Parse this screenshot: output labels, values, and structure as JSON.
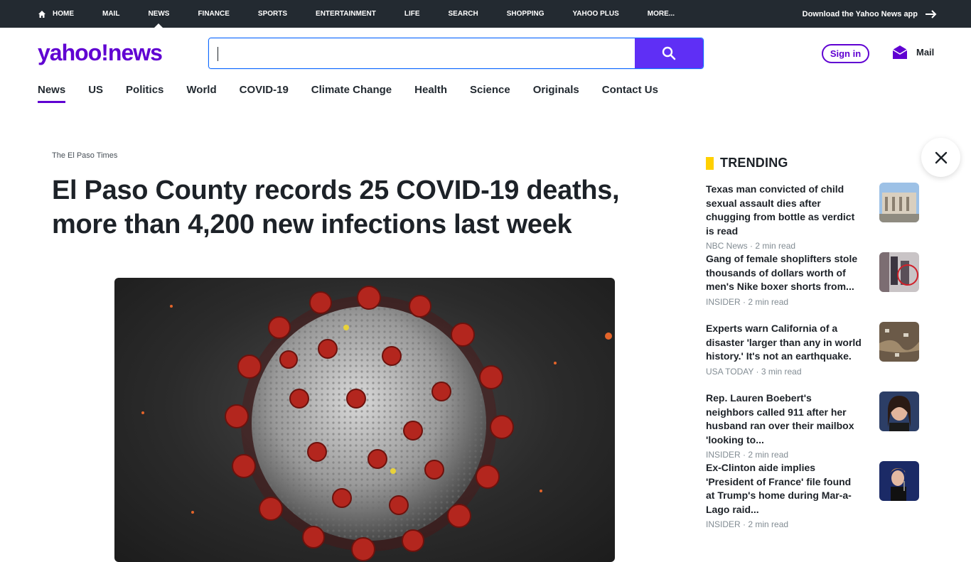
{
  "topnav": {
    "items": [
      "HOME",
      "MAIL",
      "NEWS",
      "FINANCE",
      "SPORTS",
      "ENTERTAINMENT",
      "LIFE",
      "SEARCH",
      "SHOPPING",
      "YAHOO PLUS",
      "MORE..."
    ],
    "download": "Download the Yahoo News app"
  },
  "header": {
    "logo_yahoo": "yahoo!",
    "logo_news": "news",
    "search_placeholder": "",
    "signin": "Sign in",
    "mail": "Mail"
  },
  "subnav": [
    "News",
    "US",
    "Politics",
    "World",
    "COVID-19",
    "Climate Change",
    "Health",
    "Science",
    "Originals",
    "Contact Us"
  ],
  "article": {
    "source": "The El Paso Times",
    "headline": "El Paso County records 25 COVID-19 deaths, more than 4,200 new infections last week"
  },
  "trending": {
    "heading": "TRENDING",
    "items": [
      {
        "title": "Texas man convicted of child sexual assault dies after chugging from bottle as verdict is read",
        "source": "NBC News",
        "read": "2 min read"
      },
      {
        "title": "Gang of female shoplifters stole thousands of dollars worth of men's Nike boxer shorts from...",
        "source": "INSIDER",
        "read": "2 min read"
      },
      {
        "title": "Experts warn California of a disaster 'larger than any in world history.' It's not an earthquake.",
        "source": "USA TODAY",
        "read": "3 min read"
      },
      {
        "title": "Rep. Lauren Boebert's neighbors called 911 after her husband ran over their mailbox 'looking to...",
        "source": "INSIDER",
        "read": "2 min read"
      },
      {
        "title": "Ex-Clinton aide implies 'President of France' file found at Trump's home during Mar-a-Lago raid...",
        "source": "INSIDER",
        "read": "2 min read"
      }
    ]
  },
  "colors": {
    "brand": "#6001d2",
    "search_button": "#5f2ff5",
    "topbar": "#232a31",
    "trending_accent": "#ffd000"
  }
}
